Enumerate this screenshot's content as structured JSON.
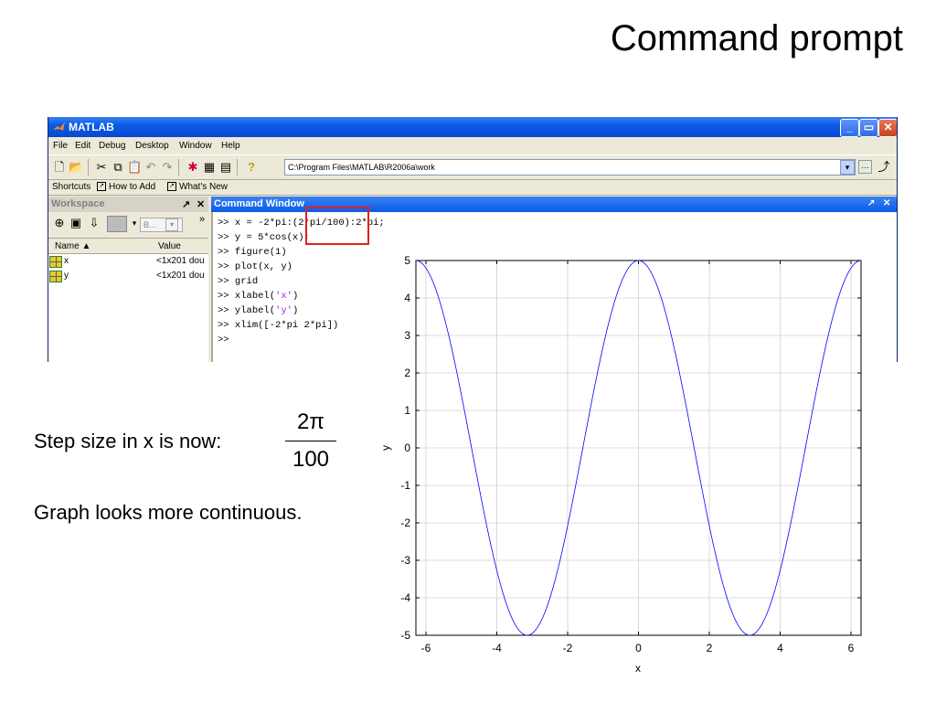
{
  "slide_title": "Command prompt",
  "matlab": {
    "title": "MATLAB",
    "menu": [
      "File",
      "Edit",
      "Debug",
      "Desktop",
      "Window",
      "Help"
    ],
    "current_directory": "C:\\Program Files\\MATLAB\\R2006a\\work",
    "shortcuts": {
      "label": "Shortcuts",
      "how_to_add": "How to Add",
      "whats_new": "What's New"
    },
    "workspace": {
      "title": "Workspace",
      "dropdown": "B...",
      "columns": [
        "Name ▲",
        "Value"
      ],
      "rows": [
        {
          "name": "x",
          "value": "<1x201 dou"
        },
        {
          "name": "y",
          "value": "<1x201 dou"
        }
      ]
    },
    "command_window": {
      "title": "Command Window",
      "prompt": ">>",
      "lines": {
        "l1": " x = -2*pi:(2*pi/100):2*pi;",
        "l2": " y = 5*cos(x);",
        "l3": " figure(1)",
        "l4": " plot(x, y)",
        "l5": " grid",
        "l6_pre": " xlabel(",
        "l6_str": "'x'",
        "l6_post": ")",
        "l7_pre": " ylabel(",
        "l7_str": "'y'",
        "l7_post": ")",
        "l8": " xlim([-2*pi 2*pi])",
        "l9": ""
      }
    }
  },
  "caption": {
    "step_text": "Step size in x is now:",
    "frac_num": "2π",
    "frac_den": "100",
    "continuous_text": "Graph looks more continuous."
  },
  "chart_data": {
    "type": "line",
    "function": "y = 5*cos(x)",
    "x_start": -6.283185,
    "x_end": 6.283185,
    "x_step": 0.0628319,
    "amplitude": 5,
    "xlim": [
      -6.2832,
      6.2832
    ],
    "ylim": [
      -5,
      5
    ],
    "xticks": [
      -6,
      -4,
      -2,
      0,
      2,
      4,
      6
    ],
    "yticks": [
      -5,
      -4,
      -3,
      -2,
      -1,
      0,
      1,
      2,
      3,
      4,
      5
    ],
    "xlabel": "x",
    "ylabel": "y",
    "grid": true,
    "line_color": "#0000ff"
  },
  "colors": {
    "highlight_box": "#e0201e",
    "string_color": "#a020f0"
  }
}
